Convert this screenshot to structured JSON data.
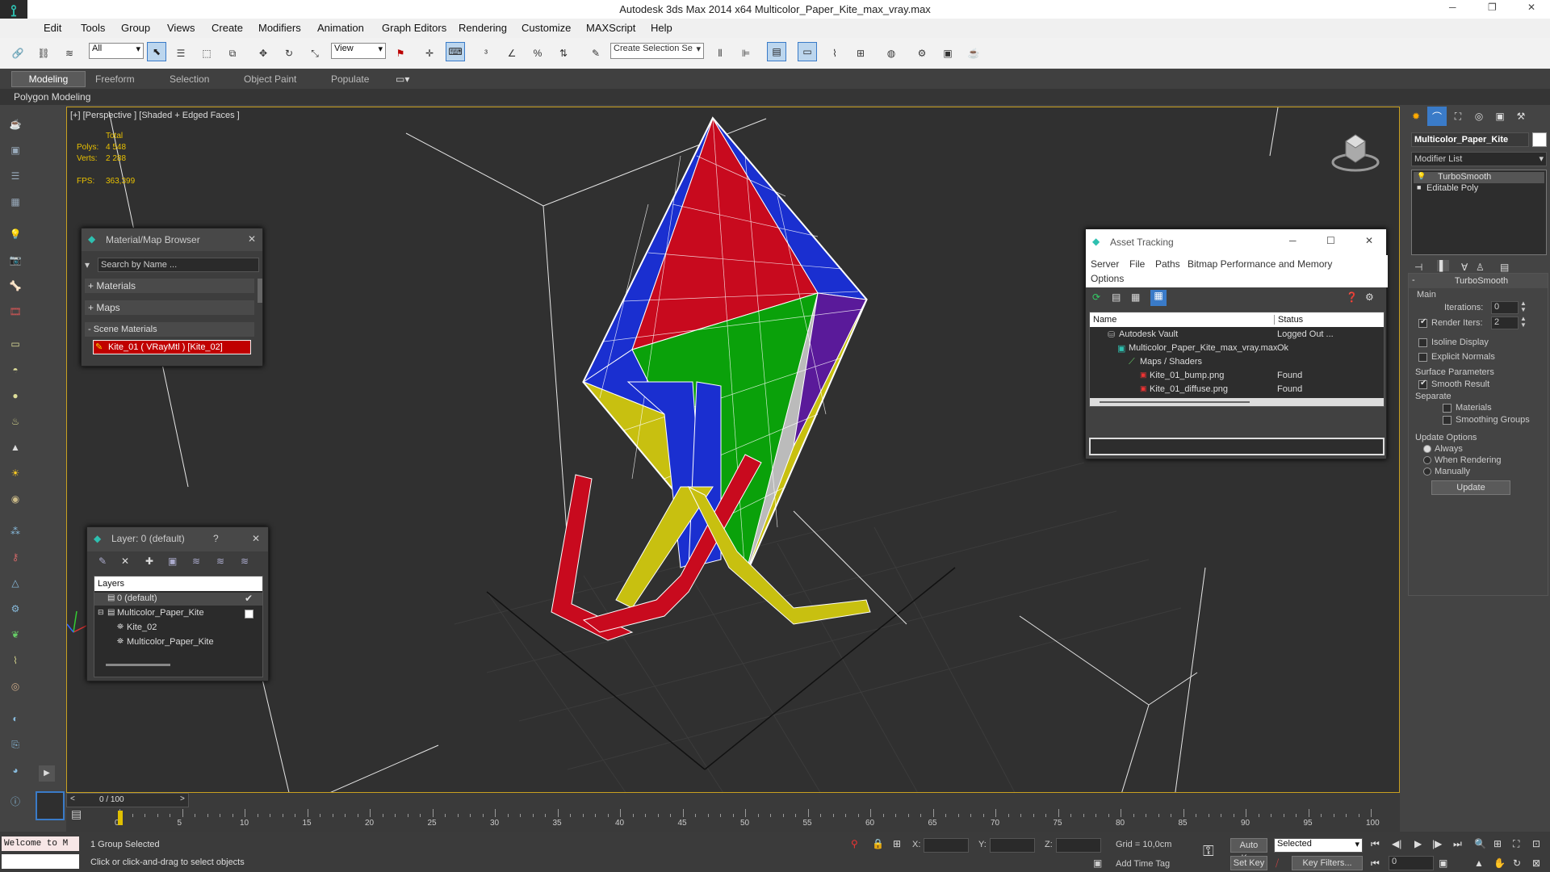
{
  "title": "Autodesk 3ds Max  2014 x64     Multicolor_Paper_Kite_max_vray.max",
  "menu": [
    "Edit",
    "Tools",
    "Group",
    "Views",
    "Create",
    "Modifiers",
    "Animation",
    "Graph Editors",
    "Rendering",
    "Customize",
    "MAXScript",
    "Help"
  ],
  "toolbar": {
    "filter": "All",
    "ref_coord": "View",
    "selection_set": "Create Selection Se"
  },
  "ribbon": {
    "tabs": [
      "Modeling",
      "Freeform",
      "Selection",
      "Object Paint",
      "Populate"
    ],
    "sub": "Polygon Modeling"
  },
  "viewport": {
    "label": "[+] [Perspective ] [Shaded + Edged Faces ]",
    "stats": {
      "total": "Total",
      "polys_label": "Polys:",
      "polys": "4 548",
      "verts_label": "Verts:",
      "verts": "2 288",
      "fps_label": "FPS:",
      "fps": "363,399"
    }
  },
  "mat_browser": {
    "title": "Material/Map Browser",
    "search": "Search by Name ...",
    "materials": "+ Materials",
    "maps": "+ Maps",
    "scene": "- Scene Materials",
    "item": "Kite_01  ( VRayMtl )  [Kite_02]"
  },
  "layer": {
    "title": "Layer: 0 (default)",
    "help": "?",
    "header": "Layers",
    "rows": [
      "0 (default)",
      "Multicolor_Paper_Kite",
      "Kite_02",
      "Multicolor_Paper_Kite"
    ]
  },
  "asset": {
    "title": "Asset Tracking",
    "menu": [
      "Server",
      "File",
      "Paths",
      "Bitmap Performance and Memory"
    ],
    "menu2": "Options",
    "col_name": "Name",
    "col_status": "Status",
    "rows": [
      {
        "name": "Autodesk Vault",
        "status": "Logged Out ..."
      },
      {
        "name": "Multicolor_Paper_Kite_max_vray.max",
        "status": "Ok"
      },
      {
        "name": "Maps / Shaders",
        "status": ""
      },
      {
        "name": "Kite_01_bump.png",
        "status": "Found"
      },
      {
        "name": "Kite_01_diffuse.png",
        "status": "Found"
      }
    ]
  },
  "cmd": {
    "object_name": "Multicolor_Paper_Kite",
    "modifier_list": "Modifier List",
    "stack": [
      "TurboSmooth",
      "Editable Poly"
    ],
    "rollout": "TurboSmooth",
    "main": "Main",
    "iterations_label": "Iterations:",
    "iterations": "0",
    "render_iters_label": "Render Iters:",
    "render_iters": "2",
    "isoline": "Isoline Display",
    "explicit": "Explicit Normals",
    "surface": "Surface Parameters",
    "smooth": "Smooth Result",
    "separate": "Separate",
    "materials": "Materials",
    "smoothing": "Smoothing Groups",
    "update_opts": "Update Options",
    "always": "Always",
    "when_render": "When Rendering",
    "manually": "Manually",
    "update": "Update"
  },
  "timeline": {
    "frame": "0 / 100",
    "ticks": [
      "0",
      "5",
      "10",
      "15",
      "20",
      "25",
      "30",
      "35",
      "40",
      "45",
      "50",
      "55",
      "60",
      "65",
      "70",
      "75",
      "80",
      "85",
      "90",
      "95",
      "100"
    ]
  },
  "status": {
    "welcome": "Welcome to M",
    "selected": "1 Group Selected",
    "prompt": "Click or click-and-drag to select objects",
    "x": "X:",
    "y": "Y:",
    "z": "Z:",
    "grid": "Grid = 10,0cm",
    "add_tag": "Add Time Tag",
    "auto_key": "Auto Key",
    "set_key": "Set Key",
    "selected_dd": "Selected",
    "key_filters": "Key Filters...",
    "frame_val": "0"
  },
  "colors": {
    "blue": "#1a2fd0",
    "red": "#c80a1e",
    "green": "#0aa10a",
    "yellow": "#c8c010",
    "purple": "#5a1a9a",
    "mat_swatch": "#c00000"
  }
}
